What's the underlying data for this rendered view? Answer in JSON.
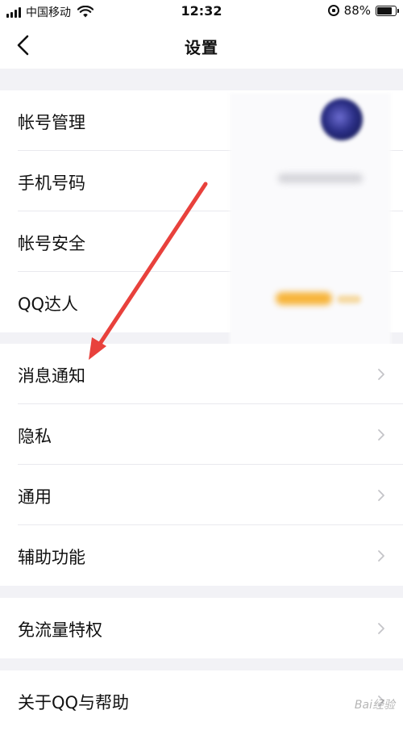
{
  "status_bar": {
    "carrier": "中国移动",
    "time": "12:32",
    "battery": "88%",
    "battery_level": 0.88
  },
  "nav": {
    "title": "设置",
    "back_icon": "chevron-left-icon"
  },
  "groups": [
    {
      "items": [
        {
          "label": "帐号管理"
        },
        {
          "label": "手机号码"
        },
        {
          "label": "帐号安全"
        },
        {
          "label": "QQ达人"
        }
      ]
    },
    {
      "items": [
        {
          "label": "消息通知"
        },
        {
          "label": "隐私"
        },
        {
          "label": "通用"
        },
        {
          "label": "辅助功能"
        }
      ]
    },
    {
      "items": [
        {
          "label": "免流量特权"
        }
      ]
    },
    {
      "items": [
        {
          "label": "关于QQ与帮助"
        }
      ]
    }
  ],
  "annotation": {
    "arrow_color": "#e8413c",
    "target": "消息通知"
  },
  "watermark": "Bai经验"
}
